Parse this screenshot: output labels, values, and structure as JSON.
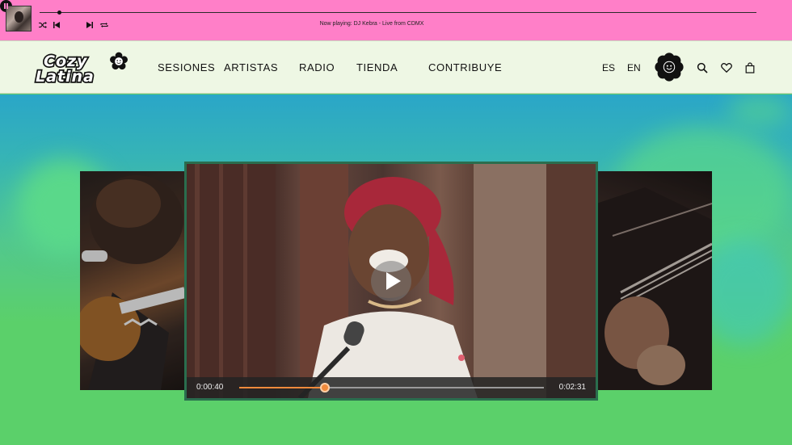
{
  "player": {
    "now_playing": "Now playing: DJ Kebra - Live from CDMX",
    "progress": 0.027
  },
  "header": {
    "logo_text": [
      "Cozy",
      "Latina"
    ],
    "nav": [
      "SESIONES",
      "ARTISTAS",
      "RADIO",
      "TIENDA",
      "CONTRIBUYE"
    ],
    "languages": [
      "ES",
      "EN"
    ],
    "icons": [
      "flower-smiley-icon",
      "search-icon",
      "heart-icon",
      "bag-icon"
    ]
  },
  "video": {
    "current_time": "0:00:40",
    "total_time": "0:02:31",
    "progress": 0.28
  },
  "colors": {
    "player_bg": "#ff7fc8",
    "header_bg": "#eef7e4",
    "hero_top": "#2aa6c8",
    "hero_bottom": "#5bd06a",
    "seek_accent": "#f08a3c"
  }
}
